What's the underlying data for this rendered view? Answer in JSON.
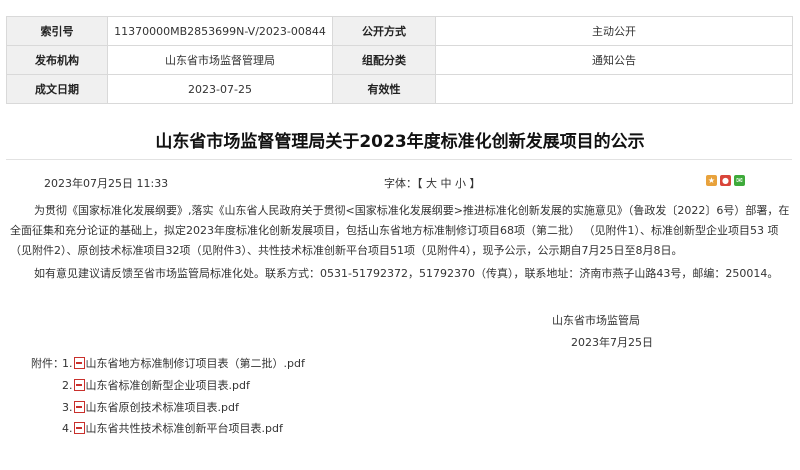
{
  "meta": {
    "index_label": "索引号",
    "index_value": "11370000MB2853699N-V/2023-00844",
    "public_mode_label": "公开方式",
    "public_mode_value": "主动公开",
    "issuer_label": "发布机构",
    "issuer_value": "山东省市场监督管理局",
    "category_label": "组配分类",
    "category_value": "通知公告",
    "date_label": "成文日期",
    "date_value": "2023-07-25",
    "validity_label": "有效性",
    "validity_value": ""
  },
  "article": {
    "title": "山东省市场监督管理局关于2023年度标准化创新发展项目的公示",
    "publish_time": "2023年07月25日 11:33",
    "font_label": "字体：",
    "font_open": "【",
    "font_large": "大",
    "font_medium": "中",
    "font_small": "小",
    "font_close": "】",
    "paragraph1": "为贯彻《国家标准化发展纲要》,落实《山东省人民政府关于贯彻<国家标准化发展纲要>推进标准化创新发展的实施意见》（鲁政发〔2022〕6号）部署，在全面征集和充分论证的基础上，拟定2023年度标准化创新发展项目，包括山东省地方标准制修订项目68项（第二批） （见附件1）、标准创新型企业项目53 项（见附件2）、原创技术标准项目32项（见附件3）、共性技术标准创新平台项目51项（见附件4），现予公示，公示期自7月25日至8月8日。",
    "paragraph2": "如有意见建议请反馈至省市场监管局标准化处。联系方式：0531-51792372，51792370（传真），联系地址：济南市燕子山路43号，邮编：250014。",
    "signature_org": "山东省市场监管局",
    "signature_date": "2023年7月25日",
    "attachments_label": "附件：",
    "attachments": [
      {
        "num": "1.",
        "name": "山东省地方标准制修订项目表（第二批）.pdf"
      },
      {
        "num": "2.",
        "name": "山东省标准创新型企业项目表.pdf"
      },
      {
        "num": "3.",
        "name": "山东省原创技术标准项目表.pdf"
      },
      {
        "num": "4.",
        "name": "山东省共性技术标准创新平台项目表.pdf"
      }
    ]
  },
  "share_icons": [
    "qzone-icon",
    "weibo-icon",
    "wechat-icon"
  ],
  "colors": {
    "share_qzone": "#e8a23c",
    "share_weibo": "#d9453a",
    "share_wechat": "#3eaa3a",
    "pdf_icon": "#c9302c"
  }
}
